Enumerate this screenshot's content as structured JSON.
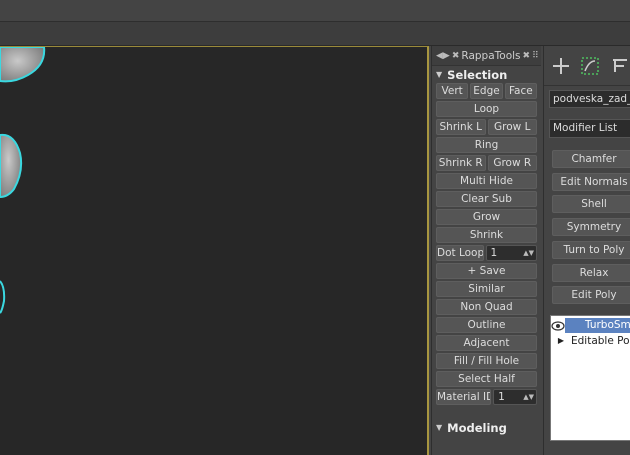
{
  "rappa_panel": {
    "title": "RappaTools",
    "sections": {
      "selection": "Selection",
      "modeling": "Modeling"
    },
    "buttons": {
      "vert": "Vert",
      "edge": "Edge",
      "face": "Face",
      "loop": "Loop",
      "shrink_l": "Shrink L",
      "grow_l": "Grow L",
      "ring": "Ring",
      "shrink_r": "Shrink R",
      "grow_r": "Grow R",
      "multi_hide": "Multi Hide",
      "clear_sub": "Clear Sub",
      "grow": "Grow",
      "shrink": "Shrink",
      "dot_loop": "Dot Loop",
      "dot_loop_value": "1",
      "save": "+ Save",
      "similar": "Similar",
      "non_quad": "Non Quad",
      "outline": "Outline",
      "adjacent": "Adjacent",
      "fill_hole": "Fill / Fill Hole",
      "select_half": "Select Half",
      "material_id": "Material ID",
      "material_id_value": "1"
    }
  },
  "command_panel": {
    "object_name": "podveska_zad_",
    "modifier_list": "Modifier List",
    "modifier_buttons": [
      "Chamfer",
      "Edit Normals",
      "Shell",
      "Symmetry",
      "Turn to Poly",
      "Relax",
      "Edit Poly"
    ],
    "stack": [
      {
        "label": "TurboSmooth",
        "selected": true
      },
      {
        "label": "Editable Poly",
        "selected": false
      }
    ]
  },
  "colors": {
    "viewport_bg": "#272727",
    "selection_highlight": "#3ad8e0",
    "active_viewport_border": "#a89640",
    "stack_selected": "#5b82c0"
  }
}
